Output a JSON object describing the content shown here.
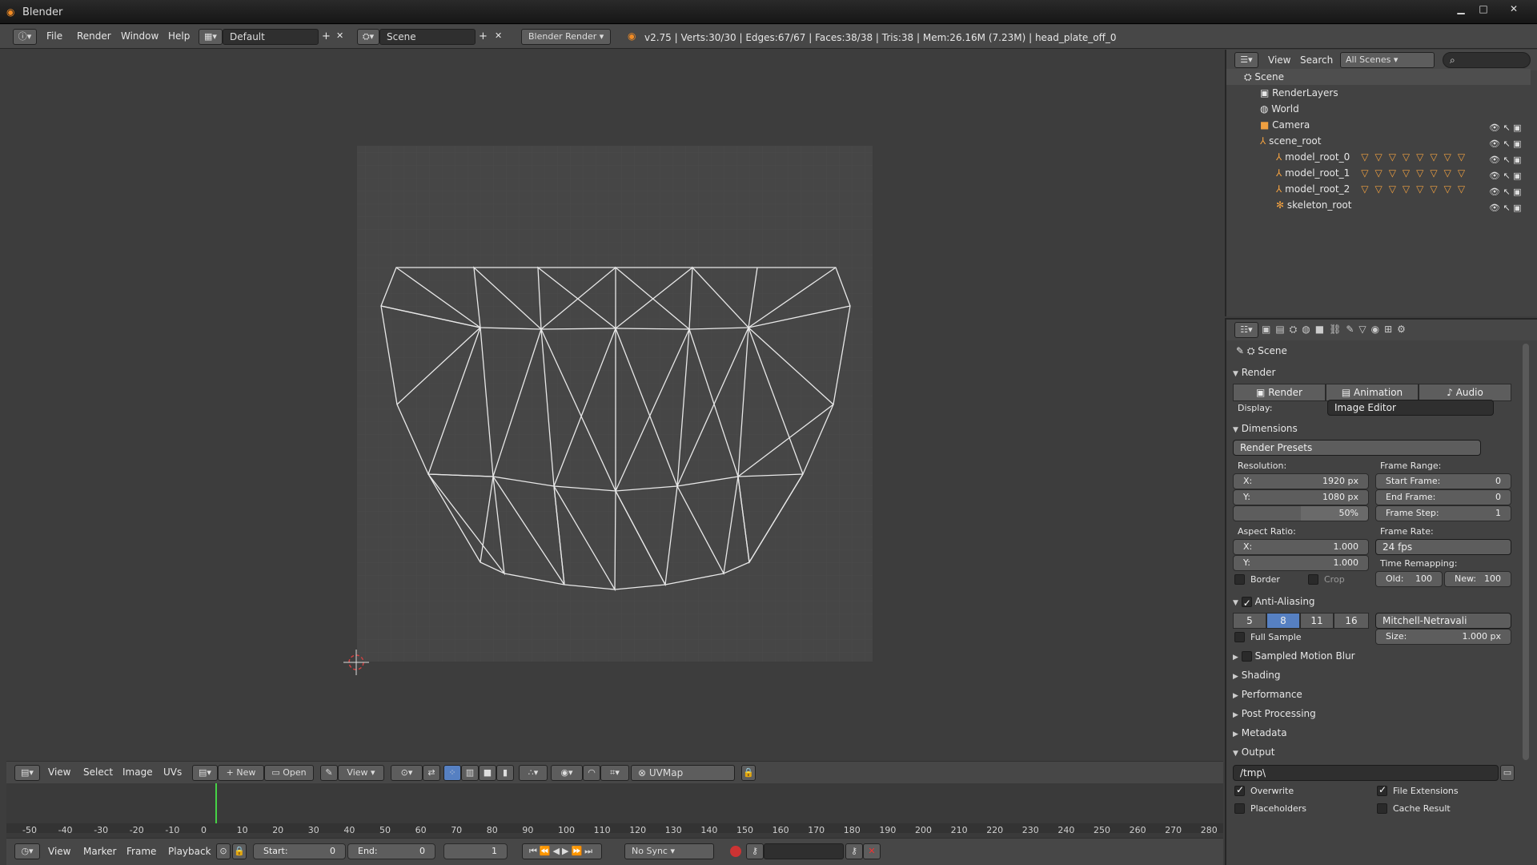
{
  "window": {
    "title": "Blender",
    "logo_icon": "blender-logo-icon"
  },
  "infobar": {
    "menus": [
      "File",
      "Render",
      "Window",
      "Help"
    ],
    "layout": "Default",
    "scene": "Scene",
    "engine": "Blender Render",
    "stats": "v2.75 | Verts:30/30 | Edges:67/67 | Faces:38/38 | Tris:38 | Mem:26.16M (7.23M) | head_plate_off_0"
  },
  "uv_header": {
    "menus": [
      "View",
      "Select",
      "Image",
      "UVs"
    ],
    "new": "New",
    "open": "Open",
    "view": "View",
    "uvmap": "UVMap"
  },
  "timeline": {
    "ticks": [
      "-50",
      "-40",
      "-30",
      "-20",
      "-10",
      "0",
      "10",
      "20",
      "30",
      "40",
      "50",
      "60",
      "70",
      "80",
      "90",
      "100",
      "110",
      "120",
      "130",
      "140",
      "150",
      "160",
      "170",
      "180",
      "190",
      "200",
      "210",
      "220",
      "230",
      "240",
      "250",
      "260",
      "270",
      "280"
    ],
    "menus": [
      "View",
      "Marker",
      "Frame",
      "Playback"
    ],
    "start_label": "Start:",
    "start": "0",
    "end_label": "End:",
    "end": "0",
    "current": "1",
    "sync": "No Sync"
  },
  "outliner": {
    "menus": [
      "View",
      "Search"
    ],
    "filter": "All Scenes",
    "items": [
      {
        "label": "Scene",
        "indent": 0
      },
      {
        "label": "RenderLayers",
        "indent": 1
      },
      {
        "label": "World",
        "indent": 1
      },
      {
        "label": "Camera",
        "indent": 1
      },
      {
        "label": "scene_root",
        "indent": 1
      },
      {
        "label": "model_root_0",
        "indent": 2
      },
      {
        "label": "model_root_1",
        "indent": 2
      },
      {
        "label": "model_root_2",
        "indent": 2
      },
      {
        "label": "skeleton_root",
        "indent": 2
      }
    ]
  },
  "props": {
    "context": "Scene",
    "render": {
      "title": "Render",
      "tabs": [
        "Render",
        "Animation",
        "Audio"
      ],
      "display_label": "Display:",
      "display": "Image Editor"
    },
    "dimensions": {
      "title": "Dimensions",
      "presets": "Render Presets",
      "resolution": "Resolution:",
      "res_x_l": "X:",
      "res_x": "1920 px",
      "res_y_l": "Y:",
      "res_y": "1080 px",
      "pct": "50%",
      "frame_range": "Frame Range:",
      "start_l": "Start Frame:",
      "start": "0",
      "end_l": "End Frame:",
      "end": "0",
      "step_l": "Frame Step:",
      "step": "1",
      "aspect": "Aspect Ratio:",
      "asp_x_l": "X:",
      "asp_x": "1.000",
      "asp_y_l": "Y:",
      "asp_y": "1.000",
      "frame_rate": "Frame Rate:",
      "fps": "24 fps",
      "time_remap": "Time Remapping:",
      "old_l": "Old:",
      "old": "100",
      "new_l": "New:",
      "new": "100",
      "border": "Border",
      "crop": "Crop"
    },
    "aa": {
      "title": "Anti-Aliasing",
      "samples": [
        "5",
        "8",
        "11",
        "16"
      ],
      "filter": "Mitchell-Netravali",
      "full_sample": "Full Sample",
      "size_l": "Size:",
      "size": "1.000 px"
    },
    "collapsed": [
      "Sampled Motion Blur",
      "Shading",
      "Performance",
      "Post Processing",
      "Metadata"
    ],
    "output": {
      "title": "Output",
      "path": "/tmp\\",
      "overwrite": "Overwrite",
      "file_ext": "File Extensions",
      "placeholders": "Placeholders",
      "cache": "Cache Result"
    }
  }
}
